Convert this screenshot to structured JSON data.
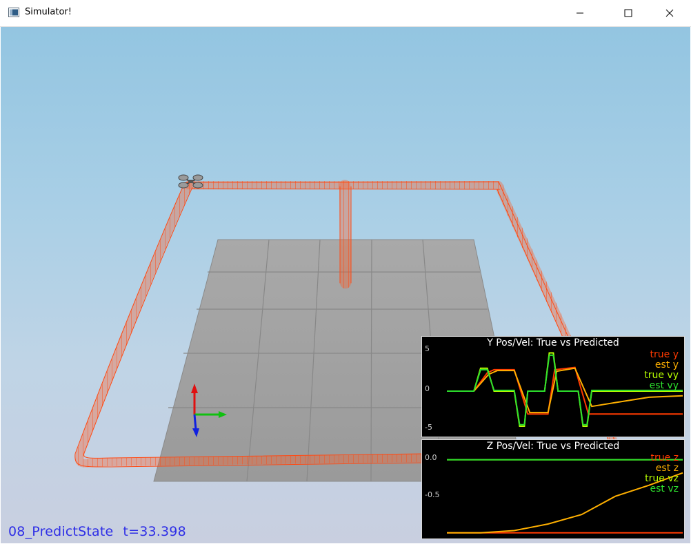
{
  "window": {
    "title": "Simulator!",
    "minimize_icon": "minimize-icon",
    "maximize_icon": "maximize-icon",
    "close_icon": "close-icon"
  },
  "status": {
    "scenario": "08_PredictState",
    "time": "t=33.398"
  },
  "colors": {
    "true_y": "#ff3a00",
    "est_y": "#ffb000",
    "true_vy": "#b8ff00",
    "est_vy": "#2de02d",
    "status_text": "#2e2ee6"
  },
  "plots": [
    {
      "title": "Y Pos/Vel: True vs Predicted",
      "ticks": [
        "5",
        "0",
        "-5"
      ],
      "legend": [
        "true y",
        "est y",
        "true vy",
        "est vy"
      ],
      "chart_data": {
        "type": "line",
        "title": "Y Pos/Vel: True vs Predicted",
        "ylim": [
          -5.5,
          5.5
        ],
        "series": [
          {
            "name": "true y",
            "points": [
              [
                0,
                0
              ],
              [
                4,
                0
              ],
              [
                6,
                2.4
              ],
              [
                7,
                2.8
              ],
              [
                10,
                2.8
              ],
              [
                12,
                -3.0
              ],
              [
                15,
                -3.0
              ],
              [
                16,
                2.8
              ],
              [
                19,
                3.1
              ],
              [
                21,
                -3.0
              ],
              [
                25,
                -3.0
              ],
              [
                35,
                -3.0
              ]
            ]
          },
          {
            "name": "est y",
            "points": [
              [
                0,
                0
              ],
              [
                4,
                0
              ],
              [
                6.2,
                2.2
              ],
              [
                7.5,
                2.7
              ],
              [
                10,
                2.7
              ],
              [
                12.3,
                -2.8
              ],
              [
                15,
                -2.8
              ],
              [
                16.3,
                2.6
              ],
              [
                19,
                3.0
              ],
              [
                21.5,
                -2.0
              ],
              [
                25,
                -1.5
              ],
              [
                30,
                -0.8
              ],
              [
                35,
                -0.6
              ]
            ]
          },
          {
            "name": "true vy",
            "points": [
              [
                0,
                0
              ],
              [
                4,
                0
              ],
              [
                5,
                3.0
              ],
              [
                6,
                3.0
              ],
              [
                7,
                0
              ],
              [
                10,
                0
              ],
              [
                10.8,
                -4.6
              ],
              [
                11.5,
                -4.6
              ],
              [
                12,
                0
              ],
              [
                14.5,
                0
              ],
              [
                15.2,
                5.0
              ],
              [
                15.8,
                5.0
              ],
              [
                16.5,
                0
              ],
              [
                19.5,
                0
              ],
              [
                20.2,
                -4.6
              ],
              [
                20.8,
                -4.6
              ],
              [
                21.5,
                0
              ],
              [
                35,
                0
              ]
            ]
          },
          {
            "name": "est vy",
            "points": [
              [
                0,
                0
              ],
              [
                4,
                0
              ],
              [
                5,
                2.8
              ],
              [
                6,
                2.8
              ],
              [
                7,
                0.1
              ],
              [
                10,
                0.1
              ],
              [
                10.8,
                -4.4
              ],
              [
                11.5,
                -4.4
              ],
              [
                12,
                0
              ],
              [
                14.5,
                0
              ],
              [
                15.2,
                4.7
              ],
              [
                15.8,
                4.7
              ],
              [
                16.5,
                0
              ],
              [
                19.5,
                0
              ],
              [
                20.2,
                -4.4
              ],
              [
                20.8,
                -4.4
              ],
              [
                21.5,
                0.1
              ],
              [
                35,
                0.1
              ]
            ]
          }
        ]
      }
    },
    {
      "title": "Z Pos/Vel: True vs Predicted",
      "ticks": [
        "0.0",
        "-0.5"
      ],
      "legend": [
        "true z",
        "est z",
        "true vz",
        "est vz"
      ],
      "chart_data": {
        "type": "line",
        "title": "Z Pos/Vel: True vs Predicted",
        "ylim": [
          -1.05,
          0.1
        ],
        "series": [
          {
            "name": "true z",
            "points": [
              [
                0,
                -1.0
              ],
              [
                35,
                -1.0
              ]
            ]
          },
          {
            "name": "est z",
            "points": [
              [
                0,
                -1.0
              ],
              [
                5,
                -1.0
              ],
              [
                10,
                -0.97
              ],
              [
                15,
                -0.88
              ],
              [
                20,
                -0.75
              ],
              [
                25,
                -0.5
              ],
              [
                30,
                -0.35
              ],
              [
                35,
                -0.18
              ]
            ]
          },
          {
            "name": "true vz",
            "points": [
              [
                0,
                0.0
              ],
              [
                35,
                0.0
              ]
            ]
          },
          {
            "name": "est vz",
            "points": [
              [
                0,
                0.0
              ],
              [
                35,
                0.0
              ]
            ]
          }
        ]
      }
    }
  ]
}
